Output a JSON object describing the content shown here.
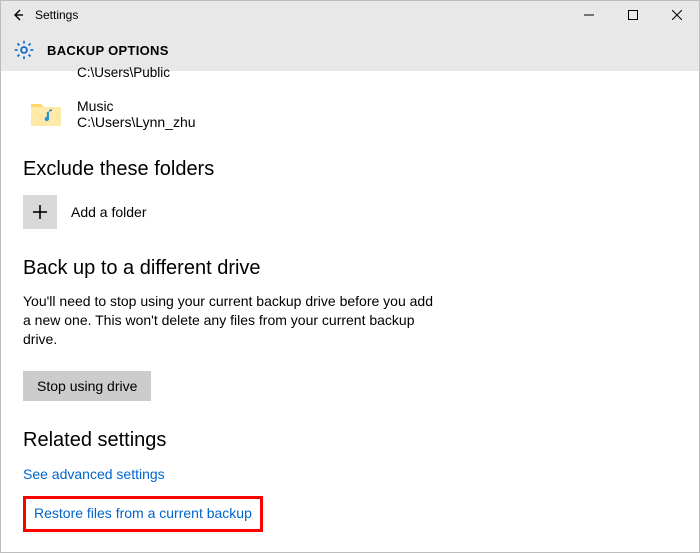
{
  "window": {
    "title": "Settings",
    "min_icon": "minimize",
    "max_icon": "maximize",
    "close_icon": "close",
    "back_icon": "back"
  },
  "header": {
    "gear_icon": "settings-gear",
    "label": "BACKUP OPTIONS"
  },
  "partial_item_path": "C:\\Users\\Public",
  "music_folder": {
    "name": "Music",
    "path": "C:\\Users\\Lynn_zhu"
  },
  "sections": {
    "exclude": "Exclude these folders",
    "add_folder_label": "Add a folder",
    "backup_drive": "Back up to a different drive",
    "backup_drive_text": "You'll need to stop using your current backup drive before you add a new one. This won't delete any files from your current backup drive.",
    "stop_button": "Stop using drive",
    "related": "Related settings",
    "advanced_link": "See advanced settings",
    "restore_link": "Restore files from a current backup"
  }
}
